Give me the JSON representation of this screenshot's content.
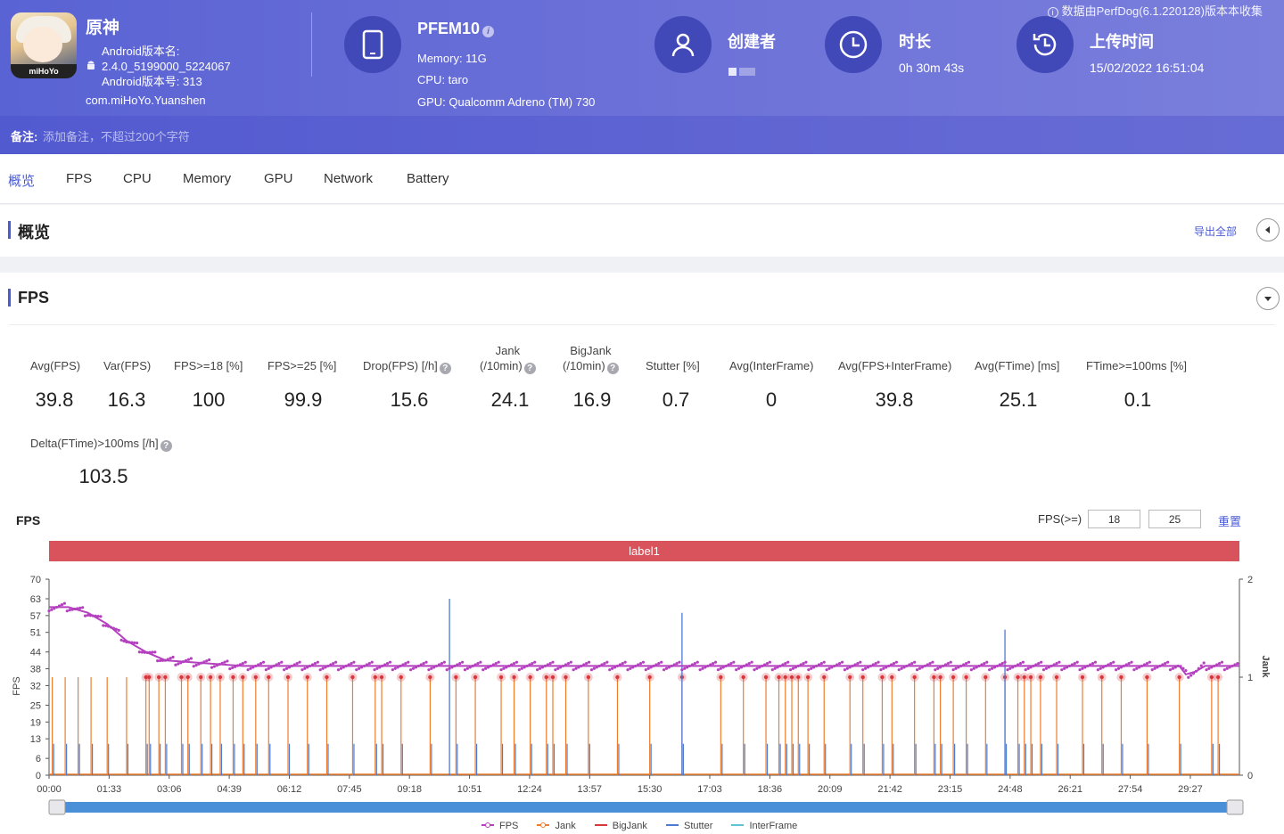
{
  "header": {
    "notice": "数据由PerfDog(6.1.220128)版本本收集",
    "app": {
      "name": "原神",
      "icon_text": "miHoYo",
      "version_name_label": "Android版本名:",
      "version_name": "2.4.0_5199000_5224067",
      "version_code": "Android版本号: 313",
      "package": "com.miHoYo.Yuanshen"
    },
    "device": {
      "name": "PFEM10",
      "memory": "Memory: 11G",
      "cpu": "CPU: taro",
      "gpu": "GPU: Qualcomm Adreno (TM) 730"
    },
    "creator": {
      "title": "创建者"
    },
    "duration": {
      "title": "时长",
      "value": "0h 30m 43s"
    },
    "upload": {
      "title": "上传时间",
      "value": "15/02/2022 16:51:04"
    },
    "remark": {
      "label": "备注:",
      "placeholder": "添加备注，不超过200个字符"
    }
  },
  "tabs": [
    "概览",
    "FPS",
    "CPU",
    "Memory",
    "GPU",
    "Network",
    "Battery"
  ],
  "overview": {
    "title": "概览",
    "export": "导出全部"
  },
  "fps_section": {
    "title": "FPS",
    "metrics": [
      {
        "label": "Avg(FPS)",
        "value": "39.8"
      },
      {
        "label": "Var(FPS)",
        "value": "16.3"
      },
      {
        "label": "FPS>=18 [%]",
        "value": "100"
      },
      {
        "label": "FPS>=25 [%]",
        "value": "99.9"
      },
      {
        "label": "Drop(FPS) [/h]",
        "value": "15.6"
      },
      {
        "label_l1": "Jank",
        "label_l2": "(/10min)",
        "value": "24.1"
      },
      {
        "label_l1": "BigJank",
        "label_l2": "(/10min)",
        "value": "16.9"
      },
      {
        "label": "Stutter [%]",
        "value": "0.7"
      },
      {
        "label": "Avg(InterFrame)",
        "value": "0"
      },
      {
        "label": "Avg(FPS+InterFrame)",
        "value": "39.8"
      },
      {
        "label": "Avg(FTime) [ms]",
        "value": "25.1"
      },
      {
        "label": "FTime>=100ms [%]",
        "value": "0.1"
      },
      {
        "label": "Delta(FTime)>100ms [/h]",
        "value": "103.5"
      }
    ],
    "chart_title": "FPS",
    "threshold_label": "FPS(>=)",
    "threshold_1": "18",
    "threshold_2": "25",
    "reset": "重置",
    "label_bar": "label1"
  },
  "chart_data": {
    "type": "line",
    "title": "FPS",
    "ylabel": "FPS",
    "y2label": "Jank",
    "ylim": [
      0,
      70
    ],
    "y2lim": [
      0,
      2
    ],
    "y_ticks": [
      0,
      6,
      13,
      19,
      25,
      32,
      38,
      44,
      51,
      57,
      63,
      70
    ],
    "y2_ticks": [
      0,
      1,
      2
    ],
    "x_ticks": [
      "00:00",
      "01:33",
      "03:06",
      "04:39",
      "06:12",
      "07:45",
      "09:18",
      "10:51",
      "12:24",
      "13:57",
      "15:30",
      "17:03",
      "18:36",
      "20:09",
      "21:42",
      "23:15",
      "24:48",
      "26:21",
      "27:54",
      "29:27"
    ],
    "xlim_seconds": [
      0,
      1843
    ],
    "series": [
      {
        "name": "FPS",
        "color": "#b43fbf",
        "points": [
          [
            0,
            60
          ],
          [
            30,
            60
          ],
          [
            60,
            58
          ],
          [
            90,
            54
          ],
          [
            120,
            48
          ],
          [
            150,
            44
          ],
          [
            180,
            41
          ],
          [
            240,
            40
          ],
          [
            300,
            39
          ],
          [
            400,
            39
          ],
          [
            500,
            39
          ],
          [
            600,
            39
          ],
          [
            700,
            39
          ],
          [
            800,
            39
          ],
          [
            900,
            39
          ],
          [
            1000,
            39
          ],
          [
            1100,
            39
          ],
          [
            1200,
            39
          ],
          [
            1300,
            39
          ],
          [
            1400,
            39
          ],
          [
            1500,
            39
          ],
          [
            1600,
            39
          ],
          [
            1700,
            39
          ],
          [
            1750,
            39
          ],
          [
            1760,
            36
          ],
          [
            1775,
            37
          ],
          [
            1790,
            39
          ],
          [
            1843,
            39
          ]
        ]
      },
      {
        "name": "Jank",
        "color": "#ef7c2c"
      },
      {
        "name": "BigJank",
        "color": "#d9363e"
      },
      {
        "name": "Stutter",
        "color": "#4b7bd4"
      },
      {
        "name": "InterFrame",
        "color": "#5fc3d4"
      }
    ],
    "jank_times_seconds": [
      5,
      25,
      45,
      65,
      90,
      120,
      150,
      155,
      170,
      180,
      205,
      215,
      235,
      250,
      265,
      285,
      300,
      320,
      340,
      370,
      400,
      430,
      470,
      505,
      515,
      545,
      590,
      630,
      660,
      700,
      720,
      745,
      770,
      780,
      800,
      835,
      880,
      930,
      980,
      1040,
      1075,
      1110,
      1130,
      1140,
      1150,
      1160,
      1175,
      1200,
      1240,
      1260,
      1290,
      1305,
      1340,
      1370,
      1380,
      1400,
      1420,
      1450,
      1480,
      1500,
      1510,
      1520,
      1535,
      1560,
      1600,
      1630,
      1660,
      1700,
      1750,
      1800,
      1810
    ],
    "jank_heights": [
      0.16,
      0.16,
      0.16,
      0.16,
      0.16,
      0.16,
      0.16,
      0.16,
      0.16,
      0.16,
      0.16,
      0.16,
      0.16,
      0.16,
      0.16,
      0.16,
      0.16,
      0.16,
      0.16,
      0.16,
      0.16,
      0.16,
      0.16,
      0.16,
      0.16,
      0.16,
      0.16,
      0.16,
      0.16,
      0.16,
      0.16,
      0.16,
      0.16,
      0.16,
      0.16,
      0.16,
      0.16,
      0.16,
      0.16,
      0.16,
      0.16,
      0.16,
      0.16,
      0.16,
      0.16,
      0.16,
      0.16,
      0.16,
      0.16,
      0.16,
      0.16,
      0.16,
      0.16,
      0.16,
      0.16,
      0.16,
      0.16,
      0.16,
      0.16,
      0.16,
      0.16,
      0.16,
      0.16,
      0.16,
      0.16,
      0.16,
      0.16,
      0.16,
      0.16,
      0.16,
      0.16
    ],
    "stutter_spikes": [
      [
        620,
        63
      ],
      [
        980,
        58
      ],
      [
        1480,
        52
      ]
    ],
    "legend": [
      "FPS",
      "Jank",
      "BigJank",
      "Stutter",
      "InterFrame"
    ],
    "legend_position": "bottom",
    "grid": false
  }
}
